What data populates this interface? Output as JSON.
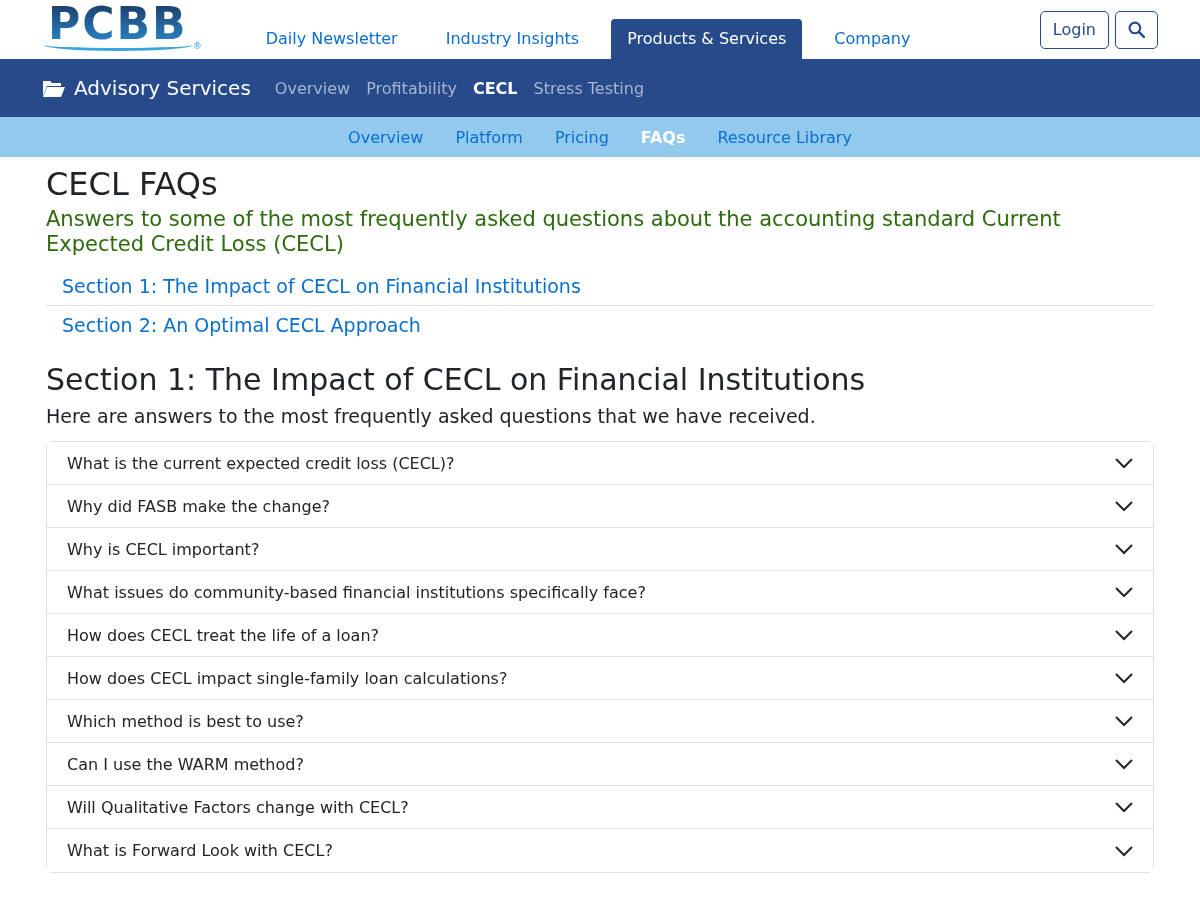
{
  "header": {
    "logo": {
      "text": "PCBB",
      "mark": "®"
    },
    "nav": [
      {
        "label": "Daily Newsletter",
        "selected": false
      },
      {
        "label": "Industry Insights",
        "selected": false
      },
      {
        "label": "Products & Services",
        "selected": true
      },
      {
        "label": "Company",
        "selected": false
      }
    ],
    "login": "Login"
  },
  "section_bar": {
    "title": "Advisory Services",
    "links": [
      {
        "label": "Overview",
        "selected": false
      },
      {
        "label": "Profitability",
        "selected": false
      },
      {
        "label": "CECL",
        "selected": true
      },
      {
        "label": "Stress Testing",
        "selected": false
      }
    ]
  },
  "sub_nav": [
    {
      "label": "Overview",
      "selected": false
    },
    {
      "label": "Platform",
      "selected": false
    },
    {
      "label": "Pricing",
      "selected": false
    },
    {
      "label": "FAQs",
      "selected": true
    },
    {
      "label": "Resource Library",
      "selected": false
    }
  ],
  "page": {
    "title": "CECL FAQs",
    "subtitle": "Answers to some of the most frequently asked questions about the accounting standard Current Expected Credit Loss (CECL)",
    "toc": [
      "Section 1: The Impact of CECL on Financial Institutions",
      "Section 2: An Optimal CECL Approach"
    ],
    "heading": "Section 1: The Impact of CECL on Financial Institutions",
    "intro": "Here are answers to the most frequently asked questions that we have received.",
    "faqs": [
      {
        "question": "What is the current expected credit loss (CECL)?",
        "expanded": false
      },
      {
        "question": "Why did FASB make the change?",
        "expanded": false
      },
      {
        "question": "Why is CECL important?",
        "expanded": false
      },
      {
        "question": "What issues do community-based financial institutions specifically face?",
        "expanded": false
      },
      {
        "question": "How does CECL treat the life of a loan?",
        "expanded": false
      },
      {
        "question": "How does CECL impact single-family loan calculations?",
        "expanded": false
      },
      {
        "question": "Which method is best to use?",
        "expanded": false
      },
      {
        "question": "Can I use the WARM method?",
        "expanded": false
      },
      {
        "question": "Will Qualitative Factors change with CECL?",
        "expanded": false
      },
      {
        "question": "What is Forward Look with CECL?",
        "expanded": false
      }
    ]
  }
}
